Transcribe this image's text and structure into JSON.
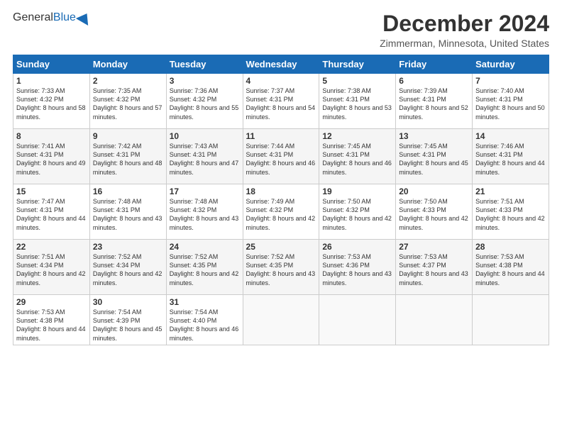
{
  "header": {
    "logo_general": "General",
    "logo_blue": "Blue",
    "month_title": "December 2024",
    "location": "Zimmerman, Minnesota, United States"
  },
  "weekdays": [
    "Sunday",
    "Monday",
    "Tuesday",
    "Wednesday",
    "Thursday",
    "Friday",
    "Saturday"
  ],
  "weeks": [
    [
      {
        "day": "1",
        "sunrise": "7:33 AM",
        "sunset": "4:32 PM",
        "daylight": "8 hours and 58 minutes."
      },
      {
        "day": "2",
        "sunrise": "7:35 AM",
        "sunset": "4:32 PM",
        "daylight": "8 hours and 57 minutes."
      },
      {
        "day": "3",
        "sunrise": "7:36 AM",
        "sunset": "4:32 PM",
        "daylight": "8 hours and 55 minutes."
      },
      {
        "day": "4",
        "sunrise": "7:37 AM",
        "sunset": "4:31 PM",
        "daylight": "8 hours and 54 minutes."
      },
      {
        "day": "5",
        "sunrise": "7:38 AM",
        "sunset": "4:31 PM",
        "daylight": "8 hours and 53 minutes."
      },
      {
        "day": "6",
        "sunrise": "7:39 AM",
        "sunset": "4:31 PM",
        "daylight": "8 hours and 52 minutes."
      },
      {
        "day": "7",
        "sunrise": "7:40 AM",
        "sunset": "4:31 PM",
        "daylight": "8 hours and 50 minutes."
      }
    ],
    [
      {
        "day": "8",
        "sunrise": "7:41 AM",
        "sunset": "4:31 PM",
        "daylight": "8 hours and 49 minutes."
      },
      {
        "day": "9",
        "sunrise": "7:42 AM",
        "sunset": "4:31 PM",
        "daylight": "8 hours and 48 minutes."
      },
      {
        "day": "10",
        "sunrise": "7:43 AM",
        "sunset": "4:31 PM",
        "daylight": "8 hours and 47 minutes."
      },
      {
        "day": "11",
        "sunrise": "7:44 AM",
        "sunset": "4:31 PM",
        "daylight": "8 hours and 46 minutes."
      },
      {
        "day": "12",
        "sunrise": "7:45 AM",
        "sunset": "4:31 PM",
        "daylight": "8 hours and 46 minutes."
      },
      {
        "day": "13",
        "sunrise": "7:45 AM",
        "sunset": "4:31 PM",
        "daylight": "8 hours and 45 minutes."
      },
      {
        "day": "14",
        "sunrise": "7:46 AM",
        "sunset": "4:31 PM",
        "daylight": "8 hours and 44 minutes."
      }
    ],
    [
      {
        "day": "15",
        "sunrise": "7:47 AM",
        "sunset": "4:31 PM",
        "daylight": "8 hours and 44 minutes."
      },
      {
        "day": "16",
        "sunrise": "7:48 AM",
        "sunset": "4:31 PM",
        "daylight": "8 hours and 43 minutes."
      },
      {
        "day": "17",
        "sunrise": "7:48 AM",
        "sunset": "4:32 PM",
        "daylight": "8 hours and 43 minutes."
      },
      {
        "day": "18",
        "sunrise": "7:49 AM",
        "sunset": "4:32 PM",
        "daylight": "8 hours and 42 minutes."
      },
      {
        "day": "19",
        "sunrise": "7:50 AM",
        "sunset": "4:32 PM",
        "daylight": "8 hours and 42 minutes."
      },
      {
        "day": "20",
        "sunrise": "7:50 AM",
        "sunset": "4:33 PM",
        "daylight": "8 hours and 42 minutes."
      },
      {
        "day": "21",
        "sunrise": "7:51 AM",
        "sunset": "4:33 PM",
        "daylight": "8 hours and 42 minutes."
      }
    ],
    [
      {
        "day": "22",
        "sunrise": "7:51 AM",
        "sunset": "4:34 PM",
        "daylight": "8 hours and 42 minutes."
      },
      {
        "day": "23",
        "sunrise": "7:52 AM",
        "sunset": "4:34 PM",
        "daylight": "8 hours and 42 minutes."
      },
      {
        "day": "24",
        "sunrise": "7:52 AM",
        "sunset": "4:35 PM",
        "daylight": "8 hours and 42 minutes."
      },
      {
        "day": "25",
        "sunrise": "7:52 AM",
        "sunset": "4:35 PM",
        "daylight": "8 hours and 43 minutes."
      },
      {
        "day": "26",
        "sunrise": "7:53 AM",
        "sunset": "4:36 PM",
        "daylight": "8 hours and 43 minutes."
      },
      {
        "day": "27",
        "sunrise": "7:53 AM",
        "sunset": "4:37 PM",
        "daylight": "8 hours and 43 minutes."
      },
      {
        "day": "28",
        "sunrise": "7:53 AM",
        "sunset": "4:38 PM",
        "daylight": "8 hours and 44 minutes."
      }
    ],
    [
      {
        "day": "29",
        "sunrise": "7:53 AM",
        "sunset": "4:38 PM",
        "daylight": "8 hours and 44 minutes."
      },
      {
        "day": "30",
        "sunrise": "7:54 AM",
        "sunset": "4:39 PM",
        "daylight": "8 hours and 45 minutes."
      },
      {
        "day": "31",
        "sunrise": "7:54 AM",
        "sunset": "4:40 PM",
        "daylight": "8 hours and 46 minutes."
      },
      null,
      null,
      null,
      null
    ]
  ],
  "labels": {
    "sunrise": "Sunrise:",
    "sunset": "Sunset:",
    "daylight": "Daylight:"
  }
}
